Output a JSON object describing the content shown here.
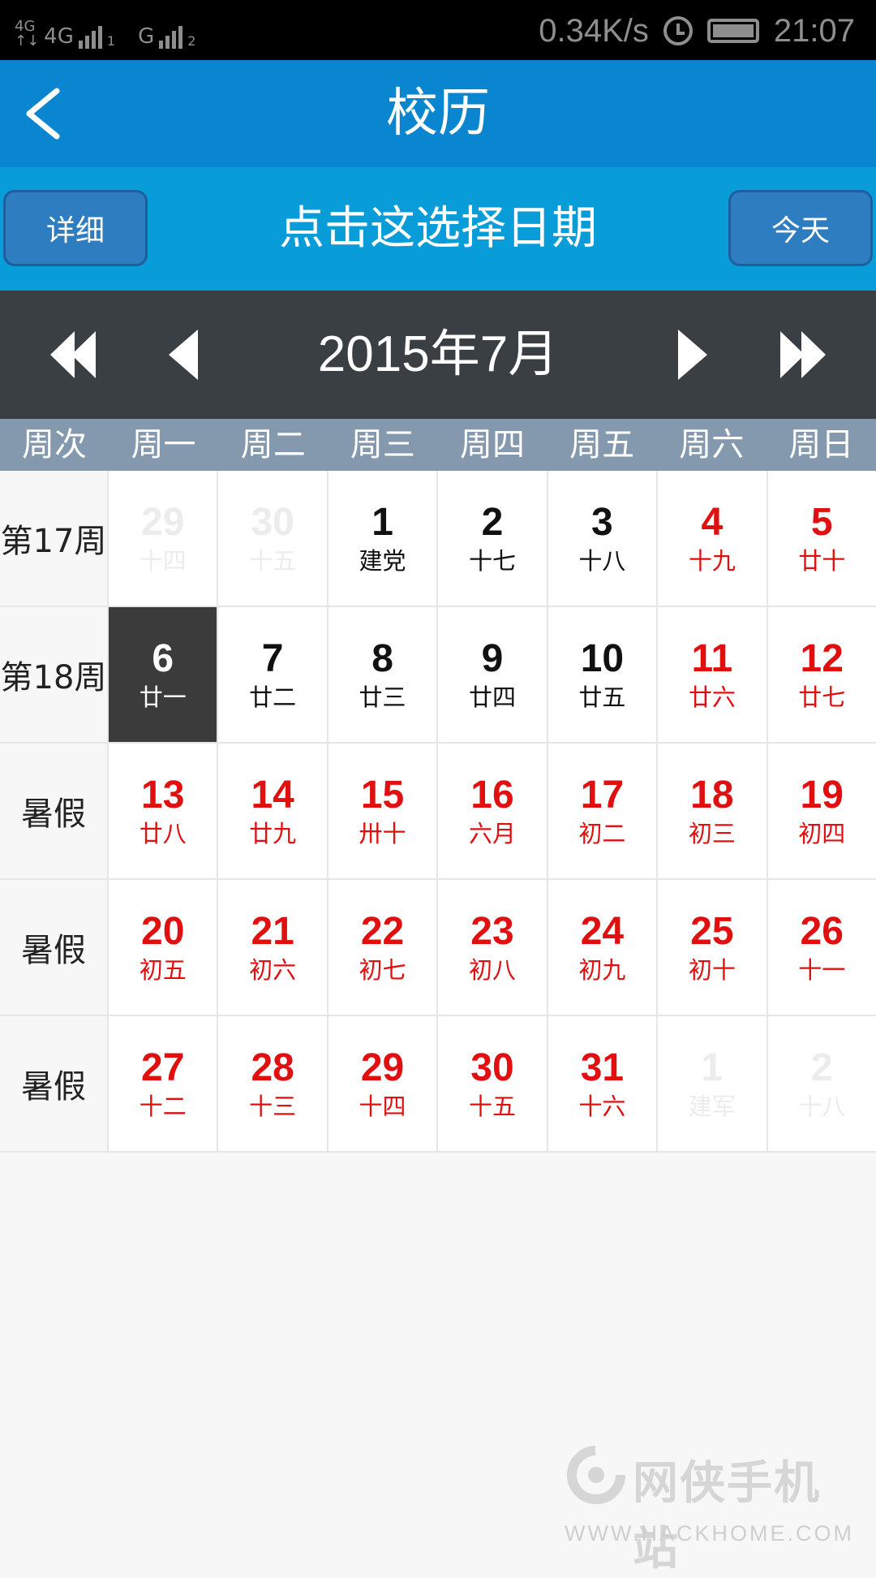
{
  "status_bar": {
    "net1_top": "4G",
    "net1_bottom": "↑↓",
    "net2": "4G",
    "sim1": "1",
    "net3": "G",
    "sim2": "2",
    "speed": "0.34K/s",
    "time": "21:07",
    "icons": [
      "signal-icon",
      "alarm-icon",
      "battery-icon"
    ]
  },
  "header": {
    "title": "校历",
    "back_icon": "chevron-left-icon"
  },
  "toolbar": {
    "detail_label": "详细",
    "pick_label": "点击这选择日期",
    "today_label": "今天"
  },
  "month_nav": {
    "label": "2015年7月",
    "icons": [
      "double-left-icon",
      "left-icon",
      "right-icon",
      "double-right-icon"
    ]
  },
  "week_header": [
    "周次",
    "周一",
    "周二",
    "周三",
    "周四",
    "周五",
    "周六",
    "周日"
  ],
  "weeks": [
    {
      "label": "第17周",
      "days": [
        {
          "d": "29",
          "l": "十四",
          "t": "dim"
        },
        {
          "d": "30",
          "l": "十五",
          "t": "dim"
        },
        {
          "d": "1",
          "l": "建党",
          "t": "normal"
        },
        {
          "d": "2",
          "l": "十七",
          "t": "normal"
        },
        {
          "d": "3",
          "l": "十八",
          "t": "normal"
        },
        {
          "d": "4",
          "l": "十九",
          "t": "red"
        },
        {
          "d": "5",
          "l": "廿十",
          "t": "red"
        }
      ]
    },
    {
      "label": "第18周",
      "days": [
        {
          "d": "6",
          "l": "廿一",
          "t": "selected"
        },
        {
          "d": "7",
          "l": "廿二",
          "t": "normal"
        },
        {
          "d": "8",
          "l": "廿三",
          "t": "normal"
        },
        {
          "d": "9",
          "l": "廿四",
          "t": "normal"
        },
        {
          "d": "10",
          "l": "廿五",
          "t": "normal"
        },
        {
          "d": "11",
          "l": "廿六",
          "t": "red"
        },
        {
          "d": "12",
          "l": "廿七",
          "t": "red"
        }
      ]
    },
    {
      "label": "暑假",
      "days": [
        {
          "d": "13",
          "l": "廿八",
          "t": "red"
        },
        {
          "d": "14",
          "l": "廿九",
          "t": "red"
        },
        {
          "d": "15",
          "l": "卅十",
          "t": "red"
        },
        {
          "d": "16",
          "l": "六月",
          "t": "red"
        },
        {
          "d": "17",
          "l": "初二",
          "t": "red"
        },
        {
          "d": "18",
          "l": "初三",
          "t": "red"
        },
        {
          "d": "19",
          "l": "初四",
          "t": "red"
        }
      ]
    },
    {
      "label": "暑假",
      "days": [
        {
          "d": "20",
          "l": "初五",
          "t": "red"
        },
        {
          "d": "21",
          "l": "初六",
          "t": "red"
        },
        {
          "d": "22",
          "l": "初七",
          "t": "red"
        },
        {
          "d": "23",
          "l": "初八",
          "t": "red"
        },
        {
          "d": "24",
          "l": "初九",
          "t": "red"
        },
        {
          "d": "25",
          "l": "初十",
          "t": "red"
        },
        {
          "d": "26",
          "l": "十一",
          "t": "red"
        }
      ]
    },
    {
      "label": "暑假",
      "days": [
        {
          "d": "27",
          "l": "十二",
          "t": "red"
        },
        {
          "d": "28",
          "l": "十三",
          "t": "red"
        },
        {
          "d": "29",
          "l": "十四",
          "t": "red"
        },
        {
          "d": "30",
          "l": "十五",
          "t": "red"
        },
        {
          "d": "31",
          "l": "十六",
          "t": "red"
        },
        {
          "d": "1",
          "l": "建军",
          "t": "dim"
        },
        {
          "d": "2",
          "l": "十八",
          "t": "dim"
        }
      ]
    }
  ],
  "colors": {
    "title_bar": "#0a86d0",
    "toolbar": "#089dd8",
    "month_bar": "#3a3f44",
    "week_header": "#8599ae",
    "holiday_red": "#e01010",
    "selected": "#3b3b3b"
  },
  "watermark": {
    "name": "网侠手机站",
    "url": "WWW.HACKHOME.COM"
  }
}
